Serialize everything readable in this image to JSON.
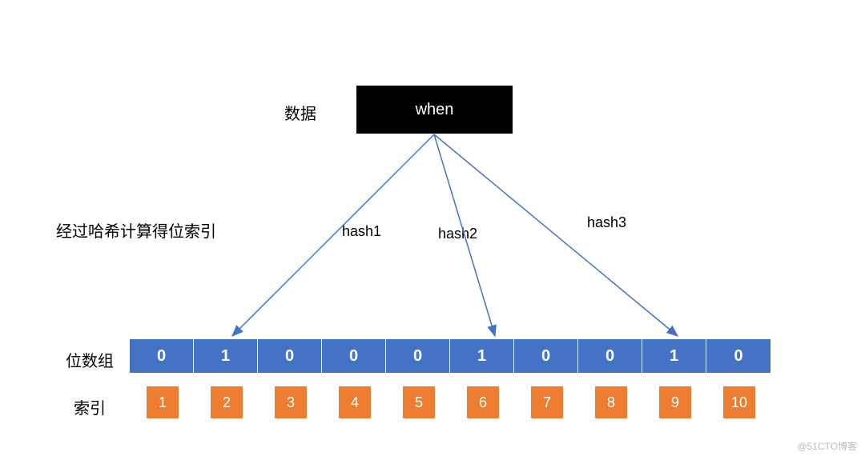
{
  "chart_data": {
    "type": "diagram",
    "data_label": "数据",
    "data_value": "when",
    "hash_caption": "经过哈希计算得位索引",
    "hash_arrows": [
      {
        "label": "hash1",
        "target_index": 2
      },
      {
        "label": "hash2",
        "target_index": 6
      },
      {
        "label": "hash3",
        "target_index": 9
      }
    ],
    "bitarray_label": "位数组",
    "bitarray": [
      0,
      1,
      0,
      0,
      0,
      1,
      0,
      0,
      1,
      0
    ],
    "index_label": "索引",
    "indices": [
      1,
      2,
      3,
      4,
      5,
      6,
      7,
      8,
      9,
      10
    ]
  },
  "watermark": "@51CTO博客"
}
